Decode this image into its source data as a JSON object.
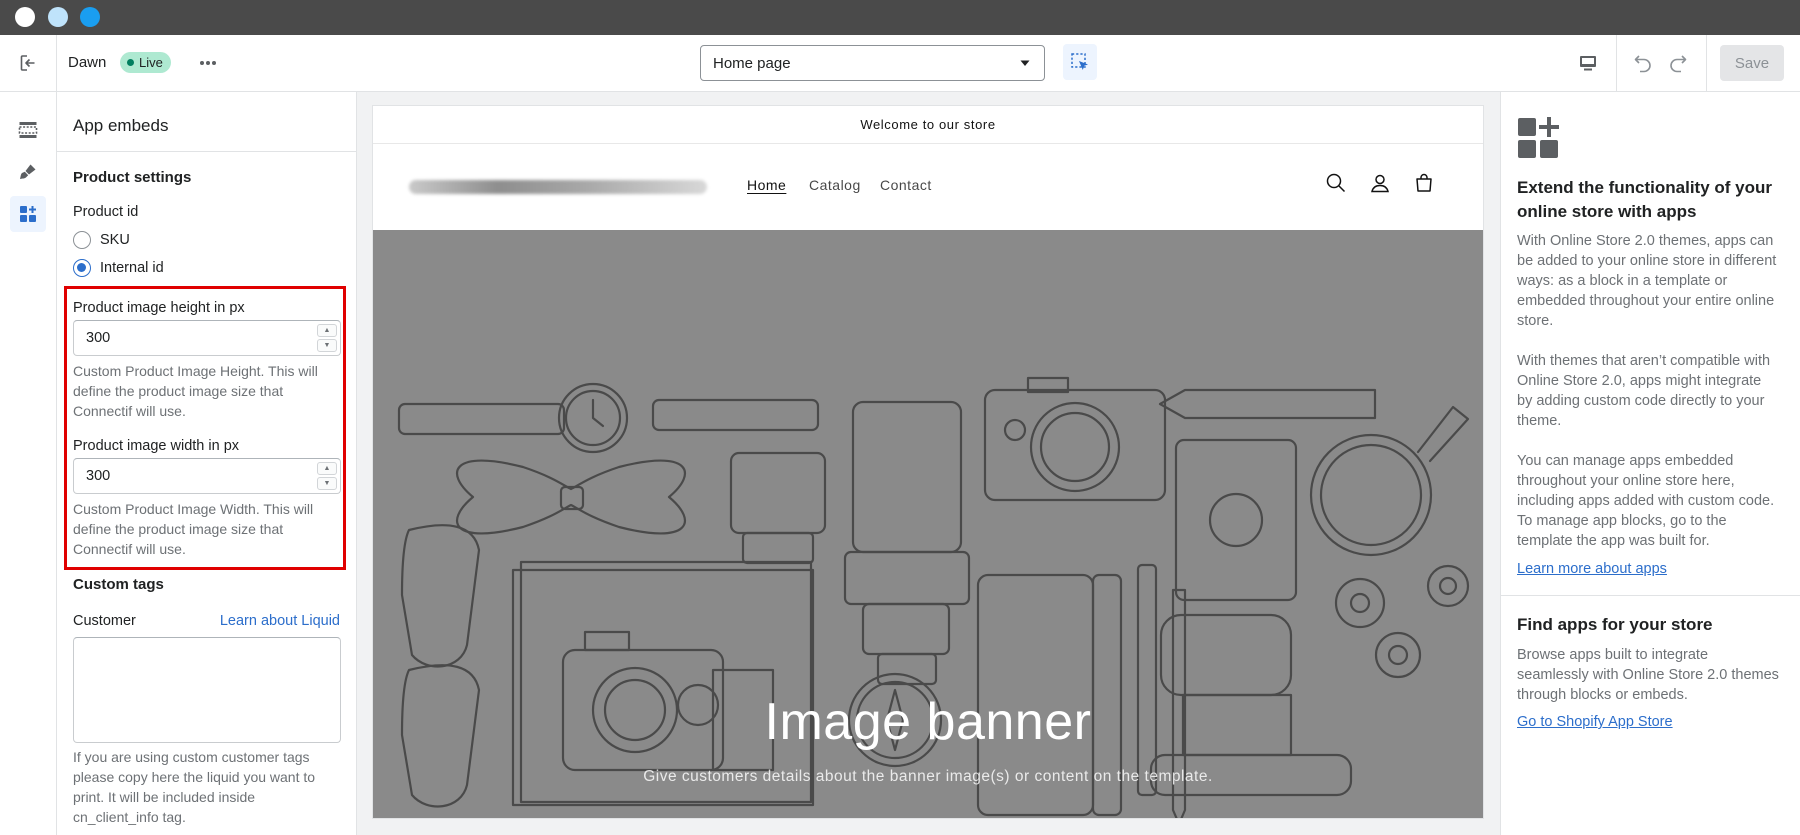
{
  "colors": {
    "accent": "#2c6ecb",
    "live_badge": "#aee9d1",
    "highlight_border": "#e00000",
    "banner_bg": "#8a8a8a"
  },
  "topbar": {
    "theme_name": "Dawn",
    "status_badge": "Live",
    "page_select": {
      "value": "Home page"
    },
    "save_label": "Save"
  },
  "settings": {
    "title": "App embeds",
    "product_settings": {
      "heading": "Product settings",
      "product_id": {
        "label": "Product id",
        "options": [
          {
            "label": "SKU",
            "selected": false
          },
          {
            "label": "Internal id",
            "selected": true
          }
        ]
      },
      "image_height": {
        "label": "Product image height in px",
        "value": "300",
        "help": "Custom Product Image Height. This will define the product image size that Connectif will use."
      },
      "image_width": {
        "label": "Product image width in px",
        "value": "300",
        "help": "Custom Product Image Width. This will define the product image size that Connectif will use."
      }
    },
    "custom_tags": {
      "heading": "Custom tags",
      "customer_label": "Customer",
      "learn_link": "Learn about Liquid",
      "customer_value": "",
      "help": "If you are using custom customer tags please copy here the liquid you want to print. It will be included inside cn_client_info tag."
    }
  },
  "preview": {
    "announcement": "Welcome to our store",
    "nav": [
      "Home",
      "Catalog",
      "Contact"
    ],
    "banner_heading": "Image banner",
    "banner_text": "Give customers details about the banner image(s) or content on the template."
  },
  "right_panel": {
    "title": "Extend the functionality of your online store with apps",
    "paragraphs": [
      "With Online Store 2.0 themes, apps can be added to your online store in different ways: as a block in a template or embedded throughout your entire online store.",
      "With themes that aren’t compatible with Online Store 2.0, apps might integrate by adding custom code directly to your theme.",
      "You can manage apps embedded throughout your online store here, including apps added with custom code. To manage app blocks, go to the template the app was built for."
    ],
    "learn_link": "Learn more about apps",
    "find_title": "Find apps for your store",
    "find_text": "Browse apps built to integrate seamlessly with Online Store 2.0 themes through blocks or embeds.",
    "store_link": "Go to Shopify App Store"
  }
}
